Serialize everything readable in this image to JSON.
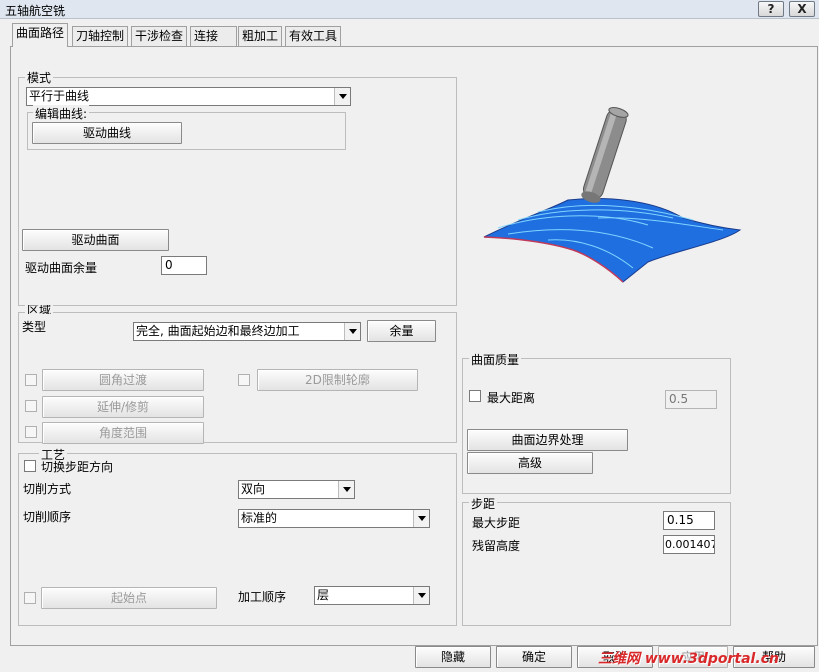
{
  "window": {
    "title": "五轴航空铣",
    "help_label": "?",
    "close_label": "X"
  },
  "tabs": [
    {
      "label": "曲面路径"
    },
    {
      "label": "刀轴控制"
    },
    {
      "label": "干涉检查"
    },
    {
      "label": "连接"
    },
    {
      "label": "粗加工"
    },
    {
      "label": "有效工具"
    }
  ],
  "mode_group": {
    "title": "模式",
    "mode_select": "平行于曲线",
    "edit_curve_title": "编辑曲线:",
    "drive_curve_button": "驱动曲线",
    "drive_surface_button": "驱动曲面",
    "drive_surface_allowance_label": "驱动曲面余量",
    "drive_surface_allowance_value": "0"
  },
  "region_group": {
    "title": "区域",
    "type_label": "类型",
    "type_select": "完全, 曲面起始边和最终边加工",
    "allowance_button": "余量",
    "fillet_button": "圆角过渡",
    "contour_2d_button": "2D限制轮廓",
    "extend_trim_button": "延伸/修剪",
    "angle_range_button": "角度范围"
  },
  "process_group": {
    "title": "工艺",
    "switch_stepover_label": "切换步距方向",
    "cut_method_label": "切削方式",
    "cut_method_select": "双向",
    "cut_order_label": "切削顺序",
    "cut_order_select": "标准的",
    "start_point_button": "起始点",
    "machining_order_label": "加工顺序",
    "machining_order_select": "层"
  },
  "surface_quality_group": {
    "title": "曲面质量",
    "max_distance_label": "最大距离",
    "max_distance_value": "0.5",
    "edge_handling_button": "曲面边界处理",
    "advanced_button": "高级"
  },
  "stepover_group": {
    "title": "步距",
    "max_stepover_label": "最大步距",
    "max_stepover_value": "0.15",
    "scallop_height_label": "残留高度",
    "scallop_height_value": "0.001407"
  },
  "bottom_buttons": {
    "hide": "隐藏",
    "ok": "确定",
    "cancel": "取消",
    "apply": "应用",
    "help": "帮助"
  },
  "watermark": "三维网 www.3dportal.cn",
  "colors": {
    "surface_blue": "#1f6fe0",
    "tool_gray": "#8c8c8c",
    "watermark_red": "#d9282a"
  }
}
